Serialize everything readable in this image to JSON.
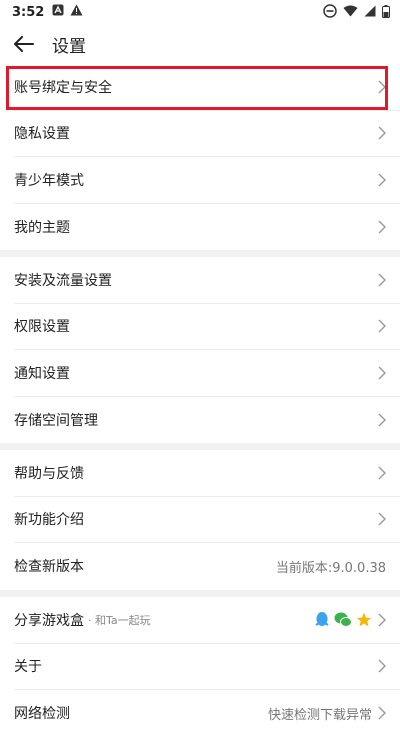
{
  "status": {
    "time": "3:52"
  },
  "header": {
    "title": "设置"
  },
  "groups": [
    {
      "items": [
        {
          "label": "账号绑定与安全"
        },
        {
          "label": "隐私设置"
        },
        {
          "label": "青少年模式"
        },
        {
          "label": "我的主题"
        }
      ]
    },
    {
      "items": [
        {
          "label": "安装及流量设置"
        },
        {
          "label": "权限设置"
        },
        {
          "label": "通知设置"
        },
        {
          "label": "存储空间管理"
        }
      ]
    },
    {
      "items": [
        {
          "label": "帮助与反馈"
        },
        {
          "label": "新功能介绍"
        },
        {
          "label": "检查新版本",
          "value": "当前版本:9.0.0.38"
        }
      ]
    },
    {
      "items": [
        {
          "label": "分享游戏盒",
          "sublabel": "· 和Ta一起玩"
        },
        {
          "label": "关于"
        },
        {
          "label": "网络检测",
          "value": "快速检测下载异常"
        }
      ]
    }
  ],
  "colors": {
    "highlight": "#e01a2b",
    "qq": "#3aa3f0",
    "wechat": "#3cb34a",
    "star": "#f5b90a"
  }
}
